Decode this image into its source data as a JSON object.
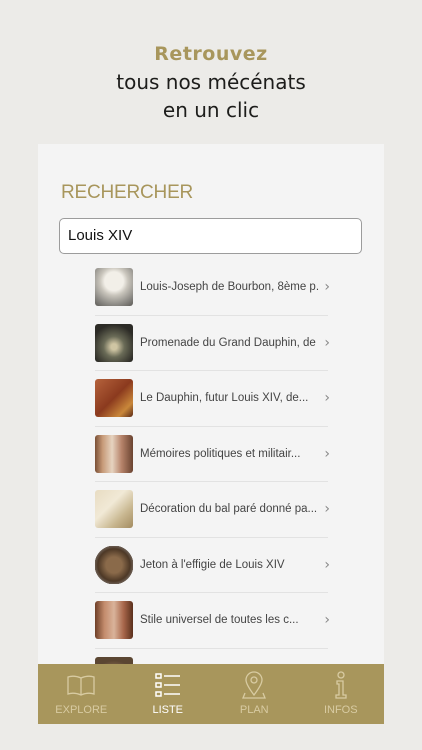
{
  "promo": {
    "accent": "Retrouvez",
    "line1": "tous nos mécénats",
    "line2": "en un clic"
  },
  "search": {
    "title": "RECHERCHER",
    "value": "Louis XIV"
  },
  "results": [
    {
      "label": "Louis-Joseph de Bourbon, 8ème p...",
      "thumb": "bust-statue"
    },
    {
      "label": "Promenade du Grand Dauphin, de ...",
      "thumb": "garden-painting"
    },
    {
      "label": "Le Dauphin, futur Louis XIV, de...",
      "thumb": "portrait-painting"
    },
    {
      "label": "Mémoires politiques et militair...",
      "thumb": "book-spine"
    },
    {
      "label": "Décoration du bal paré donné pa...",
      "thumb": "engraving"
    },
    {
      "label": "Jeton à l'effigie de Louis XIV",
      "thumb": "medal"
    },
    {
      "label": "Stile universel de toutes les c...",
      "thumb": "book-spine"
    },
    {
      "label": "",
      "thumb": "object"
    }
  ],
  "tabs": [
    {
      "label": "EXPLORE",
      "icon": "book-icon",
      "active": false
    },
    {
      "label": "LISTE",
      "icon": "list-icon",
      "active": true
    },
    {
      "label": "PLAN",
      "icon": "map-pin-icon",
      "active": false
    },
    {
      "label": "INFOS",
      "icon": "info-icon",
      "active": false
    }
  ],
  "colors": {
    "accent": "#a8965c",
    "background": "#ecebe8",
    "panel": "#f4f4f4"
  }
}
